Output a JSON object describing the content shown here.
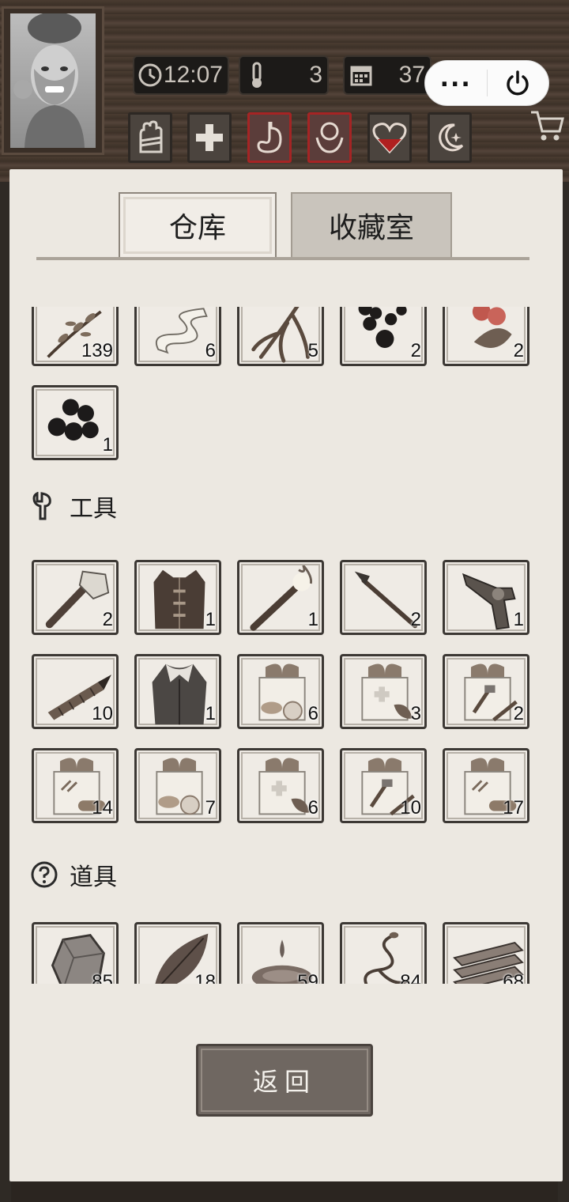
{
  "status": {
    "time": "12:07",
    "temperature": "3",
    "day": "37"
  },
  "colors": {
    "paper": "#ece8e1",
    "wood": "#4a3c31",
    "alert": "#a52424"
  },
  "categories": [
    {
      "name": "bandage",
      "alert": false
    },
    {
      "name": "medical",
      "alert": false
    },
    {
      "name": "stomach",
      "alert": true
    },
    {
      "name": "mind",
      "alert": true
    },
    {
      "name": "heart",
      "alert": false
    },
    {
      "name": "sleep",
      "alert": false
    }
  ],
  "tabs": {
    "warehouse": "仓库",
    "collection": "收藏室"
  },
  "sections": {
    "tools": "工具",
    "props": "道具"
  },
  "items_top": [
    {
      "icon": "herb-branch-icon",
      "qty": "139"
    },
    {
      "icon": "cloth-strip-icon",
      "qty": "6"
    },
    {
      "icon": "root-icon",
      "qty": "5"
    },
    {
      "icon": "black-berries-icon",
      "qty": "2"
    },
    {
      "icon": "red-berries-icon",
      "qty": "2"
    },
    {
      "icon": "blueberries-icon",
      "qty": "1"
    }
  ],
  "items_tools": [
    {
      "icon": "stone-axe-icon",
      "qty": "2"
    },
    {
      "icon": "vest-icon",
      "qty": "1"
    },
    {
      "icon": "torch-icon",
      "qty": "1"
    },
    {
      "icon": "spear-icon",
      "qty": "2"
    },
    {
      "icon": "revolver-icon",
      "qty": "1"
    },
    {
      "icon": "drill-stick-icon",
      "qty": "10"
    },
    {
      "icon": "fur-coat-icon",
      "qty": "1"
    },
    {
      "icon": "food-gift-box-icon",
      "qty": "6"
    },
    {
      "icon": "medical-gift-box-icon",
      "qty": "3"
    },
    {
      "icon": "tool-gift-box-icon",
      "qty": "2"
    },
    {
      "icon": "wood-gift-box-icon",
      "qty": "14"
    },
    {
      "icon": "food-gift-box-icon",
      "qty": "7"
    },
    {
      "icon": "medical-gift-box-icon",
      "qty": "6"
    },
    {
      "icon": "tool-gift-box-icon",
      "qty": "10"
    },
    {
      "icon": "wood-gift-box-icon",
      "qty": "17"
    }
  ],
  "items_props": [
    {
      "icon": "stone-icon",
      "qty": "85"
    },
    {
      "icon": "leaf-icon",
      "qty": "18"
    },
    {
      "icon": "water-drop-icon",
      "qty": "59"
    },
    {
      "icon": "vine-icon",
      "qty": "84"
    },
    {
      "icon": "planks-icon",
      "qty": "68"
    }
  ],
  "back_label": "返回"
}
